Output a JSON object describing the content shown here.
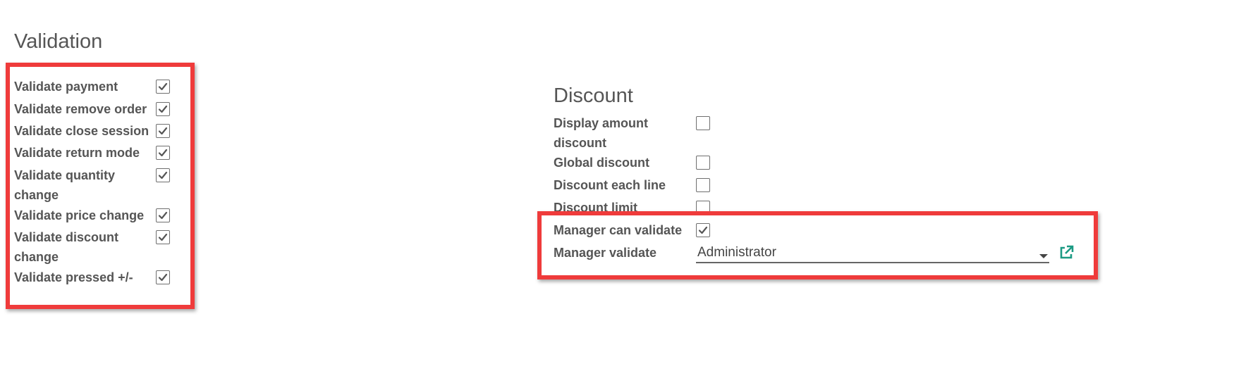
{
  "validation": {
    "title": "Validation",
    "fields": [
      {
        "label_lines": [
          "Validate payment"
        ],
        "checked": true
      },
      {
        "label_lines": [
          "Validate remove order"
        ],
        "checked": true
      },
      {
        "label_lines": [
          "Validate close session"
        ],
        "checked": true
      },
      {
        "label_lines": [
          "Validate return mode"
        ],
        "checked": true
      },
      {
        "label_lines": [
          "Validate quantity",
          "change"
        ],
        "checked": true
      },
      {
        "label_lines": [
          "Validate price change"
        ],
        "checked": true
      },
      {
        "label_lines": [
          "Validate discount",
          "change"
        ],
        "checked": true
      },
      {
        "label_lines": [
          "Validate pressed +/-"
        ],
        "checked": true
      }
    ]
  },
  "discount": {
    "title": "Discount",
    "fields": [
      {
        "label_lines": [
          "Display amount",
          "discount"
        ],
        "checked": false
      },
      {
        "label_lines": [
          "Global discount"
        ],
        "checked": false
      },
      {
        "label_lines": [
          "Discount each line"
        ],
        "checked": false
      },
      {
        "label_lines": [
          "Discount limit"
        ],
        "checked": false
      },
      {
        "label_lines": [
          "Manager can validate"
        ],
        "checked": true
      }
    ],
    "manager_validate": {
      "label": "Manager validate",
      "value": "Administrator"
    }
  },
  "colors": {
    "highlight": "#ef3b3b",
    "external_link": "#1b9a83"
  },
  "icons": {
    "check": "check-icon",
    "dropdown": "caret-down-icon",
    "external": "external-link-icon"
  }
}
